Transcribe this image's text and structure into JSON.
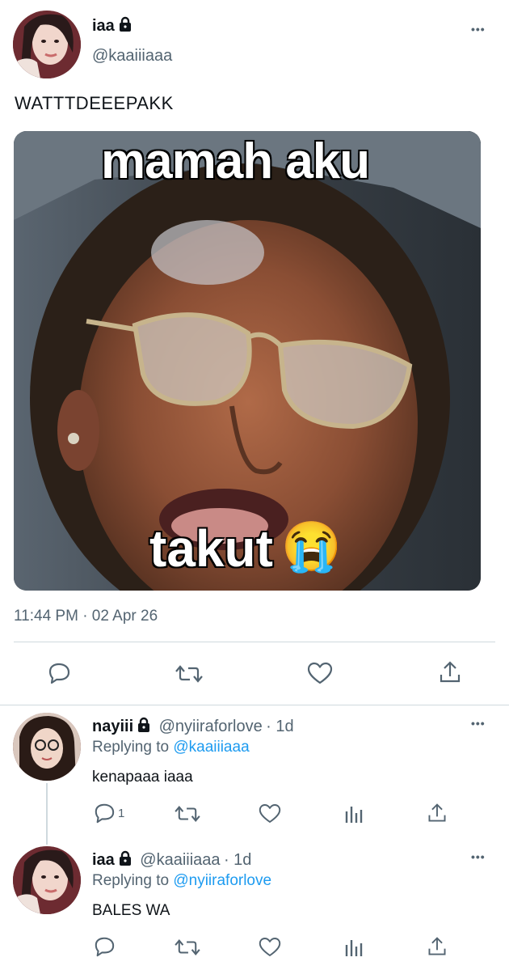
{
  "main_tweet": {
    "author_name": "iaa",
    "author_handle": "@kaaiiiaaa",
    "more": "•••",
    "text": "WATTTDEEEPAKK",
    "media": {
      "top_caption": "mamah aku",
      "bottom_caption": "takut",
      "emoji": "😭"
    },
    "timestamp": "11:44 PM · 02 Apr 26",
    "actions": [
      "reply-icon",
      "retweet-icon",
      "like-icon",
      "share-icon"
    ]
  },
  "replies": [
    {
      "author_name": "nayiii",
      "author_handle": "@nyiiraforlove",
      "age": "· 1d",
      "replying_label": "Replying to",
      "replying_to": "@kaaiiiaaa",
      "text": "kenapaaa iaaa",
      "reply_count": "1",
      "more": "•••",
      "actions": [
        "reply-icon",
        "retweet-icon",
        "like-icon",
        "analytics-icon",
        "share-icon"
      ]
    },
    {
      "author_name": "iaa",
      "author_handle": "@kaaiiiaaa",
      "age": "· 1d",
      "replying_label": "Replying to",
      "replying_to": "@nyiiraforlove",
      "text": "BALES WA",
      "reply_count": "",
      "more": "•••",
      "actions": [
        "reply-icon",
        "retweet-icon",
        "like-icon",
        "analytics-icon",
        "share-icon"
      ]
    }
  ],
  "colors": {
    "link": "#1d9bf0",
    "secondary_text": "#536471",
    "divider": "#cfd9de"
  }
}
